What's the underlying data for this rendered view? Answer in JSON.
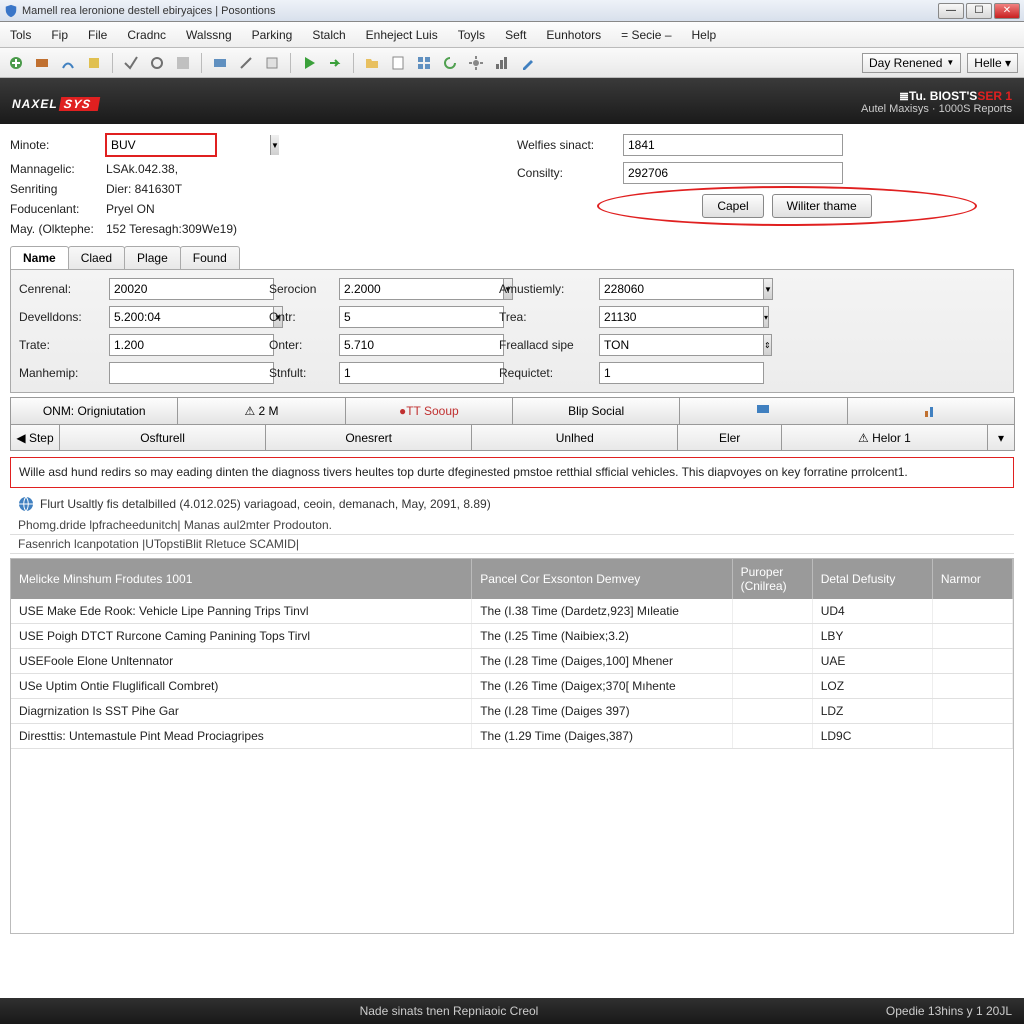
{
  "window": {
    "title": "Mamell rea leronione destell ebiryajces | Posontions"
  },
  "menu": [
    "Tols",
    "Fip",
    "File",
    "Cradnc",
    "Walssng",
    "Parking",
    "Stalch",
    "Enheject Luis",
    "Toyls",
    "Seft",
    "Eunhotors",
    "= Secie –",
    "Help"
  ],
  "toolbar_right": {
    "day_reviewed": "Day Renened",
    "help": "Helle ▾"
  },
  "brand": {
    "left1": "NAXEL",
    "left2": "SYS",
    "right_line1_a": "≣Tu.",
    "right_line1_b": "BIOST'S",
    "right_line1_c": "SER 1",
    "right_line2": "Autel Maxisys · 1000S Reports"
  },
  "upper_left": {
    "minote_label": "Minote:",
    "minote_value": "BUV",
    "row2_label": "Mannagelic:",
    "row2_value": "LSAk.042.38,",
    "row3_label": "Senriting",
    "row3_value": "Dier: 841630T",
    "row4_label": "Foducenlant:",
    "row4_value": "Pryel ON",
    "row5_label": "May. (Olktephe:",
    "row5_value": "152 Teresagh:309We19)"
  },
  "upper_right": {
    "welfies_label": "Welfies sinact:",
    "welfies_value": "1841",
    "consilty_label": "Consilty:",
    "consilty_value": "292706",
    "btn_capel": "Capel",
    "btn_wiliter": "Wiliter thame"
  },
  "tabs": [
    "Name",
    "Claed",
    "Plage",
    "Found"
  ],
  "form": {
    "r1c1l": "Cenrenal:",
    "r1c1v": "20020",
    "r1c2l": "Serocion",
    "r1c2v": "2.2000",
    "r1c3l": "Amustiemly:",
    "r1c3v": "228060",
    "r2c1l": "Develldons:",
    "r2c1v": "5.200:04",
    "r2c2l": "Ontr:",
    "r2c2v": "5",
    "r2c3l": "Trea:",
    "r2c3v": "21130",
    "r3c1l": "Trate:",
    "r3c1v": "1.200",
    "r3c2l": "Onter:",
    "r3c2v": "5.710",
    "r3c3l": "Freallacd sipe",
    "r3c3v": "TON",
    "r4c1l": "Manhemip:",
    "r4c1v": "",
    "r4c2l": "Stnfult:",
    "r4c2v": "1",
    "r4c3l": "Requictet:",
    "r4c3v": "1"
  },
  "actions1": [
    "ONM: Origniutation",
    "⚠ 2 M",
    "●TT Sooup",
    "Blip Social",
    "",
    ""
  ],
  "actions2_back": "◀ Step",
  "actions2": [
    "Osfturell",
    "Onesrert",
    "Unlhed",
    "Eler",
    "⚠ Helor 1"
  ],
  "notice": "Wille asd hund redirs so may eading dinten the diagnoss tivers heultes top durte dfeginested pmstoe retthial sfficial vehicles. This diapvoyes on key forratine prrolcent1.",
  "subinfo": "Flurt Usaltly fis detalbilled (4.012.025) variagoad, ceoin, demanach, May, 2091, 8.89)",
  "sublines": [
    "Phomg.dride lpfracheedunitch| Manas aul2mter Prodouton.",
    "Fasenrich lcanpotation |UTopstiBlit Rletuce SCAMID|"
  ],
  "table": {
    "headers": [
      "Melicke Minshum Frodutes 1001",
      "Pancel Cor Exsonton Demvey",
      "Puroper (Cnilrea)",
      "Detal Defusity",
      "Narmor"
    ],
    "rows": [
      [
        "USE Make Ede Rook: Vehicle Lipe Panning Trips Tinvl",
        "The (I.38 Time (Dardetz,923] Mıleatie",
        "",
        "UD4",
        ""
      ],
      [
        "USE Poigh DTCT Rurcone Caming Panining Tops Tirvl",
        "The (I.25 Time (Naibiex;3.2)",
        "",
        "LBY",
        ""
      ],
      [
        "USEFoole Elone Unltennator",
        "The (I.28 Time (Daiges,100] Mhener",
        "",
        "UAE",
        ""
      ],
      [
        "USe Uptim Ontie Fluglificall Combret)",
        "The (I.26 Time (Daigex;370[ Mıhente",
        "",
        "LOZ",
        ""
      ],
      [
        "Diagrnization Is SST Pihe Gar",
        "The (I.28 Time (Daiges 397)",
        "",
        "LDZ",
        ""
      ],
      [
        "Diresttis: Untemastule Pint Mead Prociagripes",
        "The (1.29 Time (Daiges,387)",
        "",
        "LD9C",
        ""
      ]
    ]
  },
  "status": {
    "center": "Nade sinats tnen Repniaoic Creol",
    "right": "Opedie 13hins y 1 20JL"
  }
}
